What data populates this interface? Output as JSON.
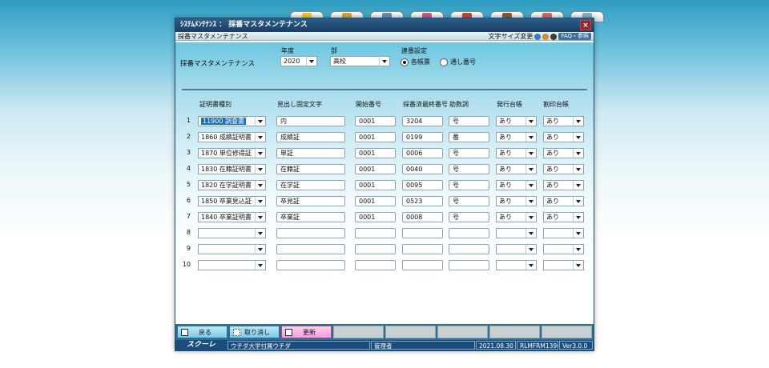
{
  "app": {
    "title": "ｼｽﾃﾑﾒﾝﾃﾅﾝｽ ： 採番マスタメンテナンス",
    "subtitle": "採番マスタメンテナンス",
    "close_label": "×",
    "font_size_label": "文字サイズ変更",
    "faq_label": "FAQ・参照",
    "launcher_colors": [
      "#f4c430",
      "#d9a441",
      "#6f8fa8",
      "#c45f8e",
      "#c4473f",
      "#8a5a3c",
      "#d46a6a",
      "#8faec0"
    ]
  },
  "form": {
    "title": "採番マスタメンテナンス",
    "year_label": "年度",
    "year_value": "2020",
    "dept_label": "部",
    "dept_value": "高校",
    "serial_label": "連番設定",
    "radio_each": "各帳票",
    "radio_through": "通し番号",
    "radio_selected": "各帳票"
  },
  "columns": {
    "cert_type": "証明書種別",
    "fixed_text": "見出し固定文字",
    "start_no": "開始番号",
    "last_no": "採番済最終番号",
    "suffix": "助数詞",
    "ledger": "発行台帳",
    "seal": "割印台帳"
  },
  "rows": [
    {
      "num": "1",
      "cert": "11900 調査書",
      "fixed": "内",
      "start": "0001",
      "last": "3204",
      "suffix": "号",
      "ledger": "あり",
      "seal": "あり"
    },
    {
      "num": "2",
      "cert": "1860 成績証明書",
      "fixed": "成績証",
      "start": "0001",
      "last": "0199",
      "suffix": "番",
      "ledger": "あり",
      "seal": "あり"
    },
    {
      "num": "3",
      "cert": "1870 単位修得証",
      "fixed": "単証",
      "start": "0001",
      "last": "0006",
      "suffix": "号",
      "ledger": "あり",
      "seal": "あり"
    },
    {
      "num": "4",
      "cert": "1830 在籍証明書",
      "fixed": "在籍証",
      "start": "0001",
      "last": "0040",
      "suffix": "号",
      "ledger": "あり",
      "seal": "あり"
    },
    {
      "num": "5",
      "cert": "1820 在学証明書",
      "fixed": "在学証",
      "start": "0001",
      "last": "0095",
      "suffix": "号",
      "ledger": "あり",
      "seal": "あり"
    },
    {
      "num": "6",
      "cert": "1850 卒業見込証",
      "fixed": "卒見証",
      "start": "0001",
      "last": "0523",
      "suffix": "号",
      "ledger": "あり",
      "seal": "あり"
    },
    {
      "num": "7",
      "cert": "1840 卒業証明書",
      "fixed": "卒業証",
      "start": "0001",
      "last": "0008",
      "suffix": "号",
      "ledger": "あり",
      "seal": "あり"
    },
    {
      "num": "8",
      "cert": "",
      "fixed": "",
      "start": "",
      "last": "",
      "suffix": "",
      "ledger": "",
      "seal": ""
    },
    {
      "num": "9",
      "cert": "",
      "fixed": "",
      "start": "",
      "last": "",
      "suffix": "",
      "ledger": "",
      "seal": ""
    },
    {
      "num": "10",
      "cert": "",
      "fixed": "",
      "start": "",
      "last": "",
      "suffix": "",
      "ledger": "",
      "seal": ""
    }
  ],
  "footer": {
    "back_label": "戻る",
    "cancel_label": "取り消し",
    "update_label": "更新",
    "logo": "スクーレ",
    "school": "ウチダ大学付属ウチダ",
    "user": "管理者",
    "date": "2021.08.30",
    "screen_id": "RLMFRM1390",
    "version": "Ver3.0.0"
  }
}
